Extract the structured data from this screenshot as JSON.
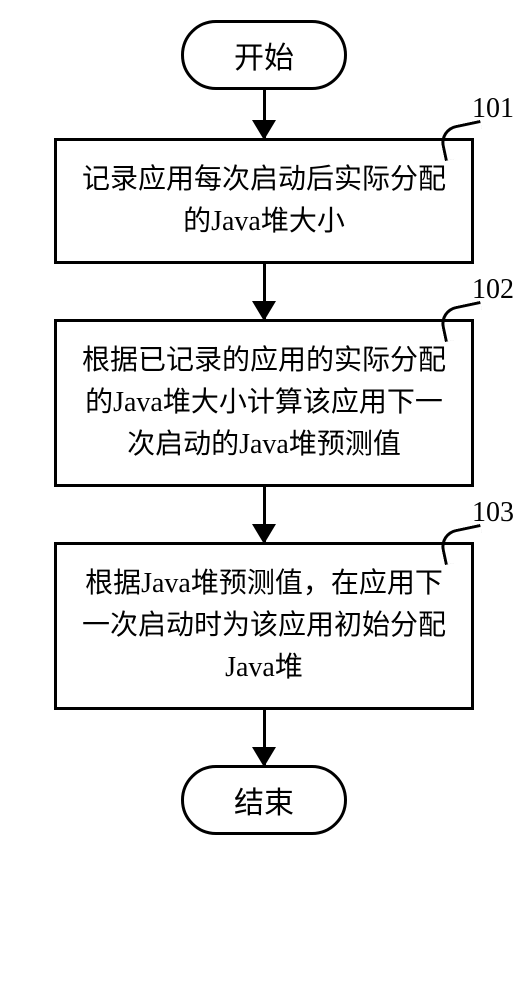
{
  "chart_data": {
    "type": "flowchart",
    "nodes": [
      {
        "id": "start",
        "type": "terminal",
        "text": "开始"
      },
      {
        "id": "step1",
        "type": "process",
        "label": "101",
        "text": "记录应用每次启动后实际分配的Java堆大小"
      },
      {
        "id": "step2",
        "type": "process",
        "label": "102",
        "text": "根据已记录的应用的实际分配的Java堆大小计算该应用下一次启动的Java堆预测值"
      },
      {
        "id": "step3",
        "type": "process",
        "label": "103",
        "text": "根据Java堆预测值，在应用下一次启动时为该应用初始分配Java堆"
      },
      {
        "id": "end",
        "type": "terminal",
        "text": "结束"
      }
    ],
    "edges": [
      {
        "from": "start",
        "to": "step1"
      },
      {
        "from": "step1",
        "to": "step2"
      },
      {
        "from": "step2",
        "to": "step3"
      },
      {
        "from": "step3",
        "to": "end"
      }
    ]
  }
}
